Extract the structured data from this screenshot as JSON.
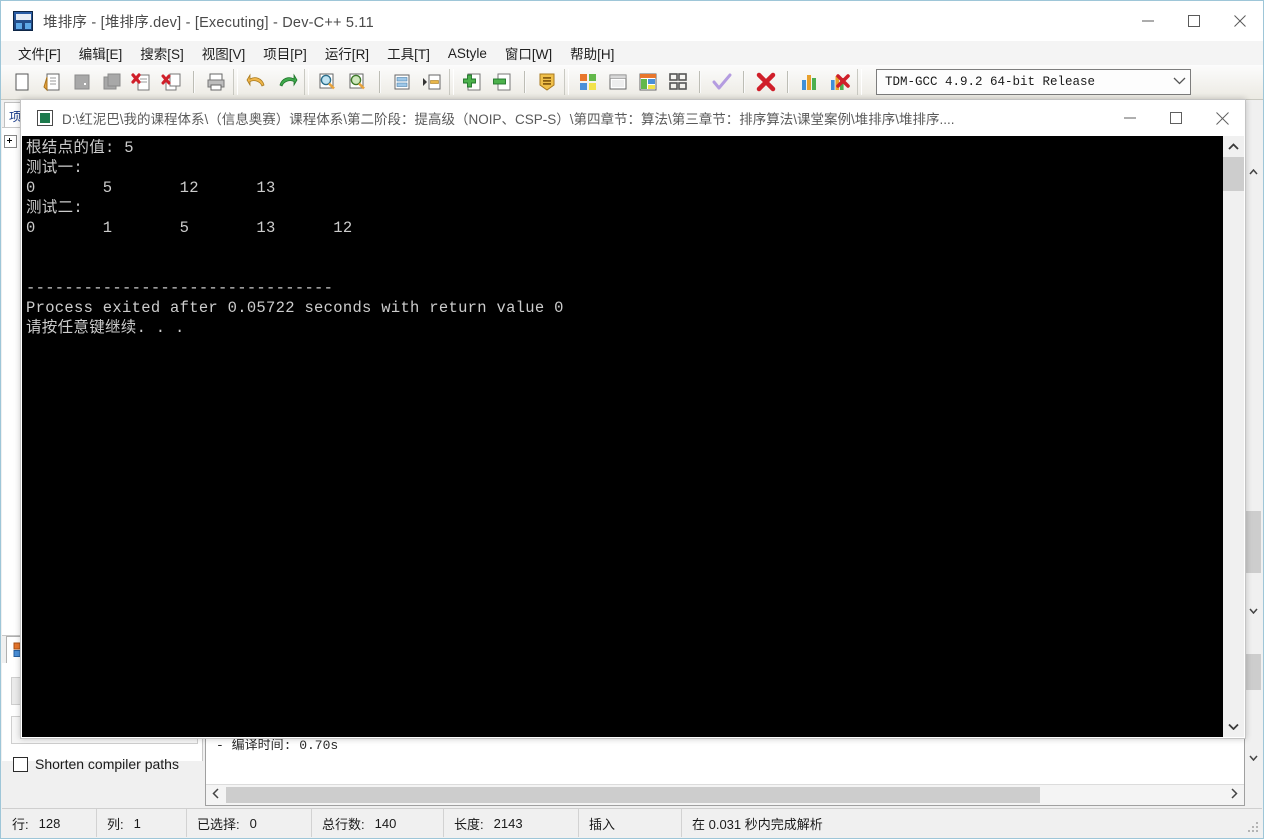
{
  "ide": {
    "title": "堆排序 - [堆排序.dev] - [Executing] - Dev-C++ 5.11",
    "window_buttons": {
      "minimize": "minimize-icon",
      "maximize": "maximize-icon",
      "close": "close-icon"
    },
    "menu": [
      {
        "label": "文件[F]",
        "name": "menu-file"
      },
      {
        "label": "编辑[E]",
        "name": "menu-edit"
      },
      {
        "label": "搜索[S]",
        "name": "menu-search"
      },
      {
        "label": "视图[V]",
        "name": "menu-view"
      },
      {
        "label": "项目[P]",
        "name": "menu-project"
      },
      {
        "label": "运行[R]",
        "name": "menu-run"
      },
      {
        "label": "工具[T]",
        "name": "menu-tools"
      },
      {
        "label": "AStyle",
        "name": "menu-astyle"
      },
      {
        "label": "窗口[W]",
        "name": "menu-window"
      },
      {
        "label": "帮助[H]",
        "name": "menu-help"
      }
    ],
    "toolbar": {
      "compiler_combo_value": "TDM-GCC 4.9.2 64-bit Release",
      "icons": [
        "new-file-icon",
        "open-file-icon",
        "save-file-icon",
        "save-all-icon",
        "close-file-icon",
        "close-all-icon",
        "print-icon",
        "undo-icon",
        "redo-icon",
        "find-icon",
        "find-next-icon",
        "goto-line-icon",
        "goto-function-icon",
        "add-to-project-icon",
        "remove-from-project-icon",
        "project-options-icon",
        "compile-icon",
        "run-icon",
        "compile-and-run-icon",
        "rebuild-all-icon",
        "syntax-check-icon",
        "stop-execution-icon",
        "profile-icon",
        "delete-profile-icon"
      ]
    },
    "left_panel": {
      "tab_label": "项",
      "tree_root": ""
    },
    "compile_log": {
      "line": "- 编译时间: 0.70s"
    },
    "shorten_checkbox": {
      "label": "Shorten compiler paths",
      "checked": false
    },
    "statusbar": [
      {
        "label": "行:",
        "value": "128",
        "name": "status-row"
      },
      {
        "label": "列:",
        "value": "1",
        "name": "status-col"
      },
      {
        "label": "已选择:",
        "value": "0",
        "name": "status-selected"
      },
      {
        "label": "总行数:",
        "value": "140",
        "name": "status-total-lines"
      },
      {
        "label": "长度:",
        "value": "2143",
        "name": "status-length"
      },
      {
        "label": "插入",
        "value": "",
        "name": "status-insert-mode"
      },
      {
        "label": "在 0.031 秒内完成解析",
        "value": "",
        "name": "status-parse-time"
      }
    ]
  },
  "console": {
    "title": "D:\\红泥巴\\我的课程体系\\（信息奥赛）课程体系\\第二阶段：提高级（NOIP、CSP-S）\\第四章节：算法\\第三章节：排序算法\\课堂案例\\堆排序\\堆排序....",
    "window_buttons": {
      "minimize": "minimize-icon",
      "maximize": "maximize-icon",
      "close": "close-icon"
    },
    "output": "根结点的值: 5\n测试一:\n0       5       12      13\n测试二:\n0       1       5       13      12\n\n\n--------------------------------\nProcess exited after 0.05722 seconds with return value 0\n请按任意键继续. . .",
    "colors": {
      "background": "#000000",
      "foreground": "#cccccc"
    }
  }
}
